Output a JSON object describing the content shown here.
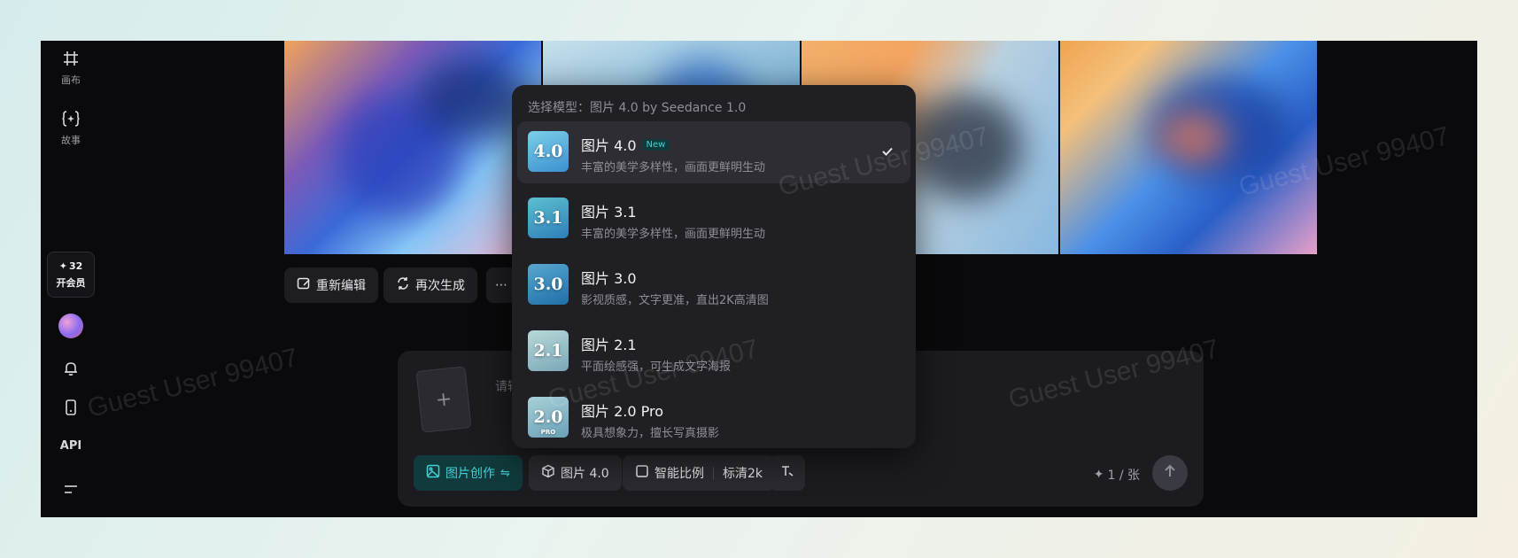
{
  "sidebar": {
    "items": [
      {
        "label": "画布",
        "icon": "canvas-icon"
      },
      {
        "label": "故事",
        "icon": "story-icon"
      }
    ],
    "vip": {
      "points": "32",
      "label": "开会员"
    },
    "api_label": "API"
  },
  "actions": {
    "reedit_label": "重新编辑",
    "regenerate_label": "再次生成",
    "more_label": "⋯"
  },
  "dropdown": {
    "title": "选择模型：图片 4.0 by Seedance 1.0",
    "models": [
      {
        "name": "图片 4.0",
        "badge": "New",
        "desc": "丰富的美学多样性，画面更鲜明生动",
        "thumb": "4.0",
        "selected": true,
        "color_a": "#3c8fd0",
        "color_b": "#7bd0e8"
      },
      {
        "name": "图片 3.1",
        "badge": "",
        "desc": "丰富的美学多样性，画面更鲜明生动",
        "thumb": "3.1",
        "selected": false,
        "color_a": "#2e7fb8",
        "color_b": "#5cc0d0"
      },
      {
        "name": "图片 3.0",
        "badge": "",
        "desc": "影视质感，文字更准，直出2K高清图",
        "thumb": "3.0",
        "selected": false,
        "color_a": "#1f6fa8",
        "color_b": "#58a8d0"
      },
      {
        "name": "图片 2.1",
        "badge": "",
        "desc": "平面绘感强，可生成文字海报",
        "thumb": "2.1",
        "selected": false,
        "color_a": "#7aa8b8",
        "color_b": "#b8d8d8"
      },
      {
        "name": "图片 2.0 Pro",
        "badge": "",
        "desc": "极具想象力，擅长写真摄影",
        "thumb": "2.0",
        "thumb_sub": "PRO",
        "selected": false,
        "color_a": "#6aa0b8",
        "color_b": "#a8d0d8"
      }
    ]
  },
  "composer": {
    "placeholder": "请输",
    "upload_symbol": "+",
    "mode_label": "图片创作",
    "model_label": "图片 4.0",
    "ratio_label": "智能比例",
    "quality_label": "标清2k",
    "credits_label": "1 / 张"
  },
  "watermark": "Guest User 99407",
  "colors": {
    "accent": "#3fd2d8",
    "app_bg": "#0a0a0c",
    "panel_bg": "#202024"
  }
}
